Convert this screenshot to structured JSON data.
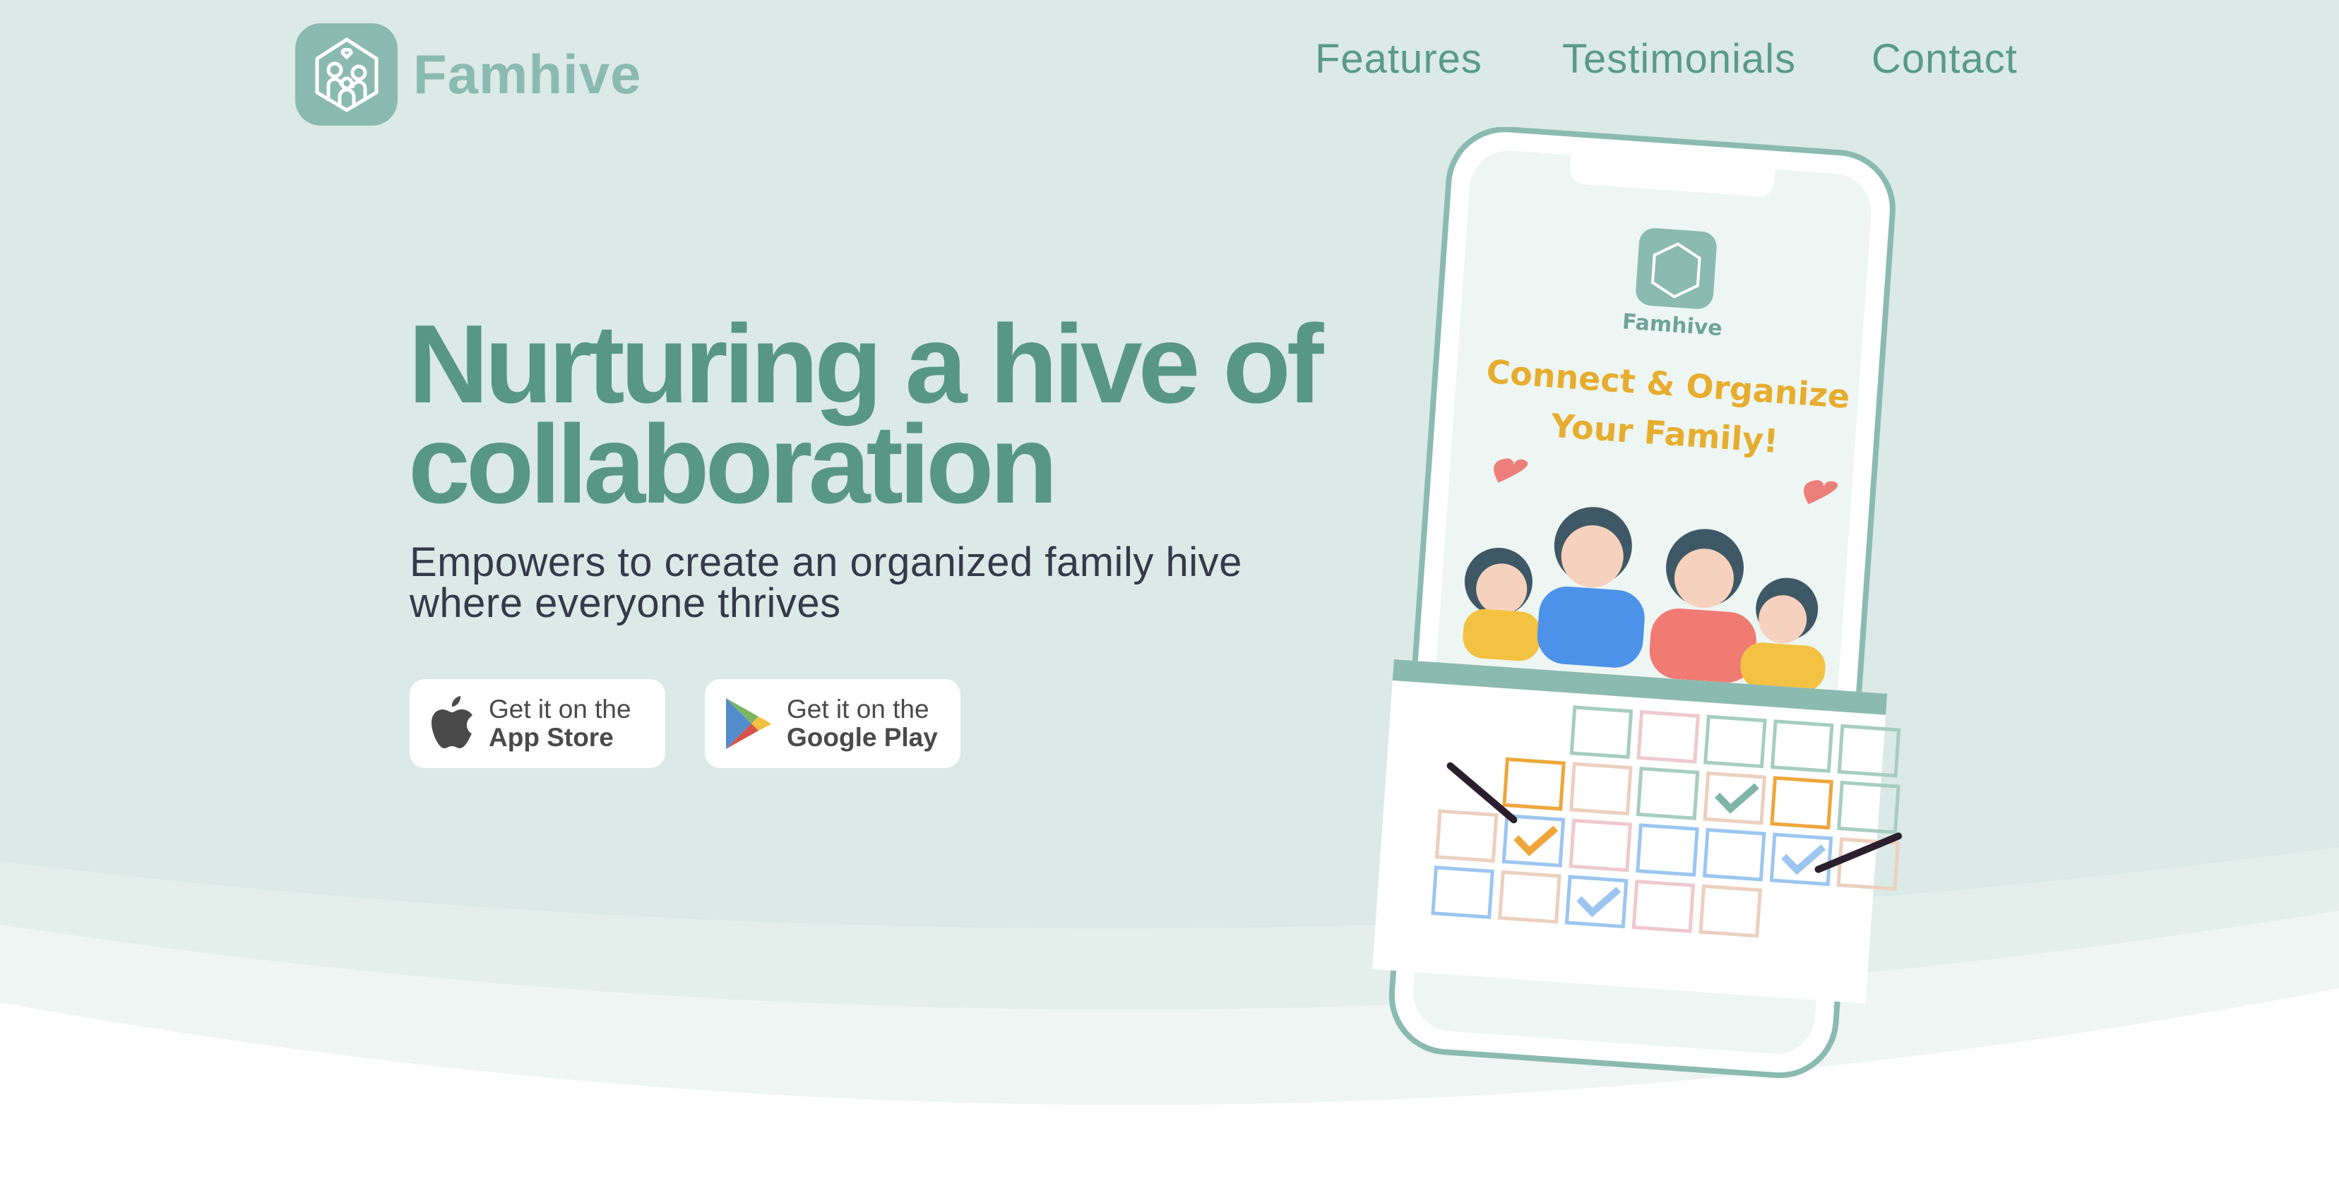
{
  "brand": {
    "name": "Famhive",
    "logo_icon": "family-house-icon"
  },
  "nav": {
    "items": [
      {
        "label": "Features"
      },
      {
        "label": "Testimonials"
      },
      {
        "label": "Contact"
      }
    ]
  },
  "hero": {
    "title_line1": "Nurturing a hive of",
    "title_line2": "collaboration",
    "subtitle_line1": "Empowers to create an organized family hive",
    "subtitle_line2": "where everyone thrives"
  },
  "stores": [
    {
      "line1": "Get it on the",
      "line2": "App Store",
      "icon": "apple-icon"
    },
    {
      "line1": "Get it on the",
      "line2": "Google Play",
      "icon": "google-play-icon"
    }
  ],
  "phone": {
    "app_name": "Famhive",
    "headline1": "Connect & Organize",
    "headline2": "Your Family!"
  },
  "colors": {
    "background": "#dbeae6",
    "accent": "#589784",
    "logo": "#8bbab0",
    "phone_headline": "#e6ad2e"
  }
}
